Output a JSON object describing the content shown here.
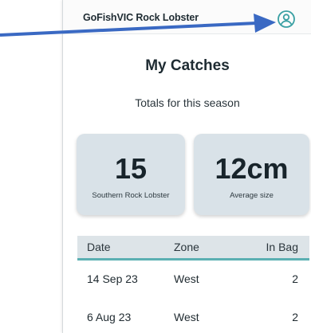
{
  "app": {
    "title": "GoFishVIC Rock Lobster"
  },
  "header": {
    "account_icon": "user-circle-icon",
    "accent_color": "#3aa0a3"
  },
  "page": {
    "title": "My Catches",
    "subtitle": "Totals for this season"
  },
  "stats": [
    {
      "value": "15",
      "label": "Southern Rock Lobster"
    },
    {
      "value": "12cm",
      "label": "Average size"
    }
  ],
  "table": {
    "columns": [
      "Date",
      "Zone",
      "In Bag"
    ],
    "rows": [
      {
        "date": "14 Sep 23",
        "zone": "West",
        "in_bag": "2"
      },
      {
        "date": "6 Aug 23",
        "zone": "West",
        "in_bag": "2"
      }
    ]
  },
  "annotation": {
    "type": "arrow",
    "color": "#3a69c3"
  }
}
